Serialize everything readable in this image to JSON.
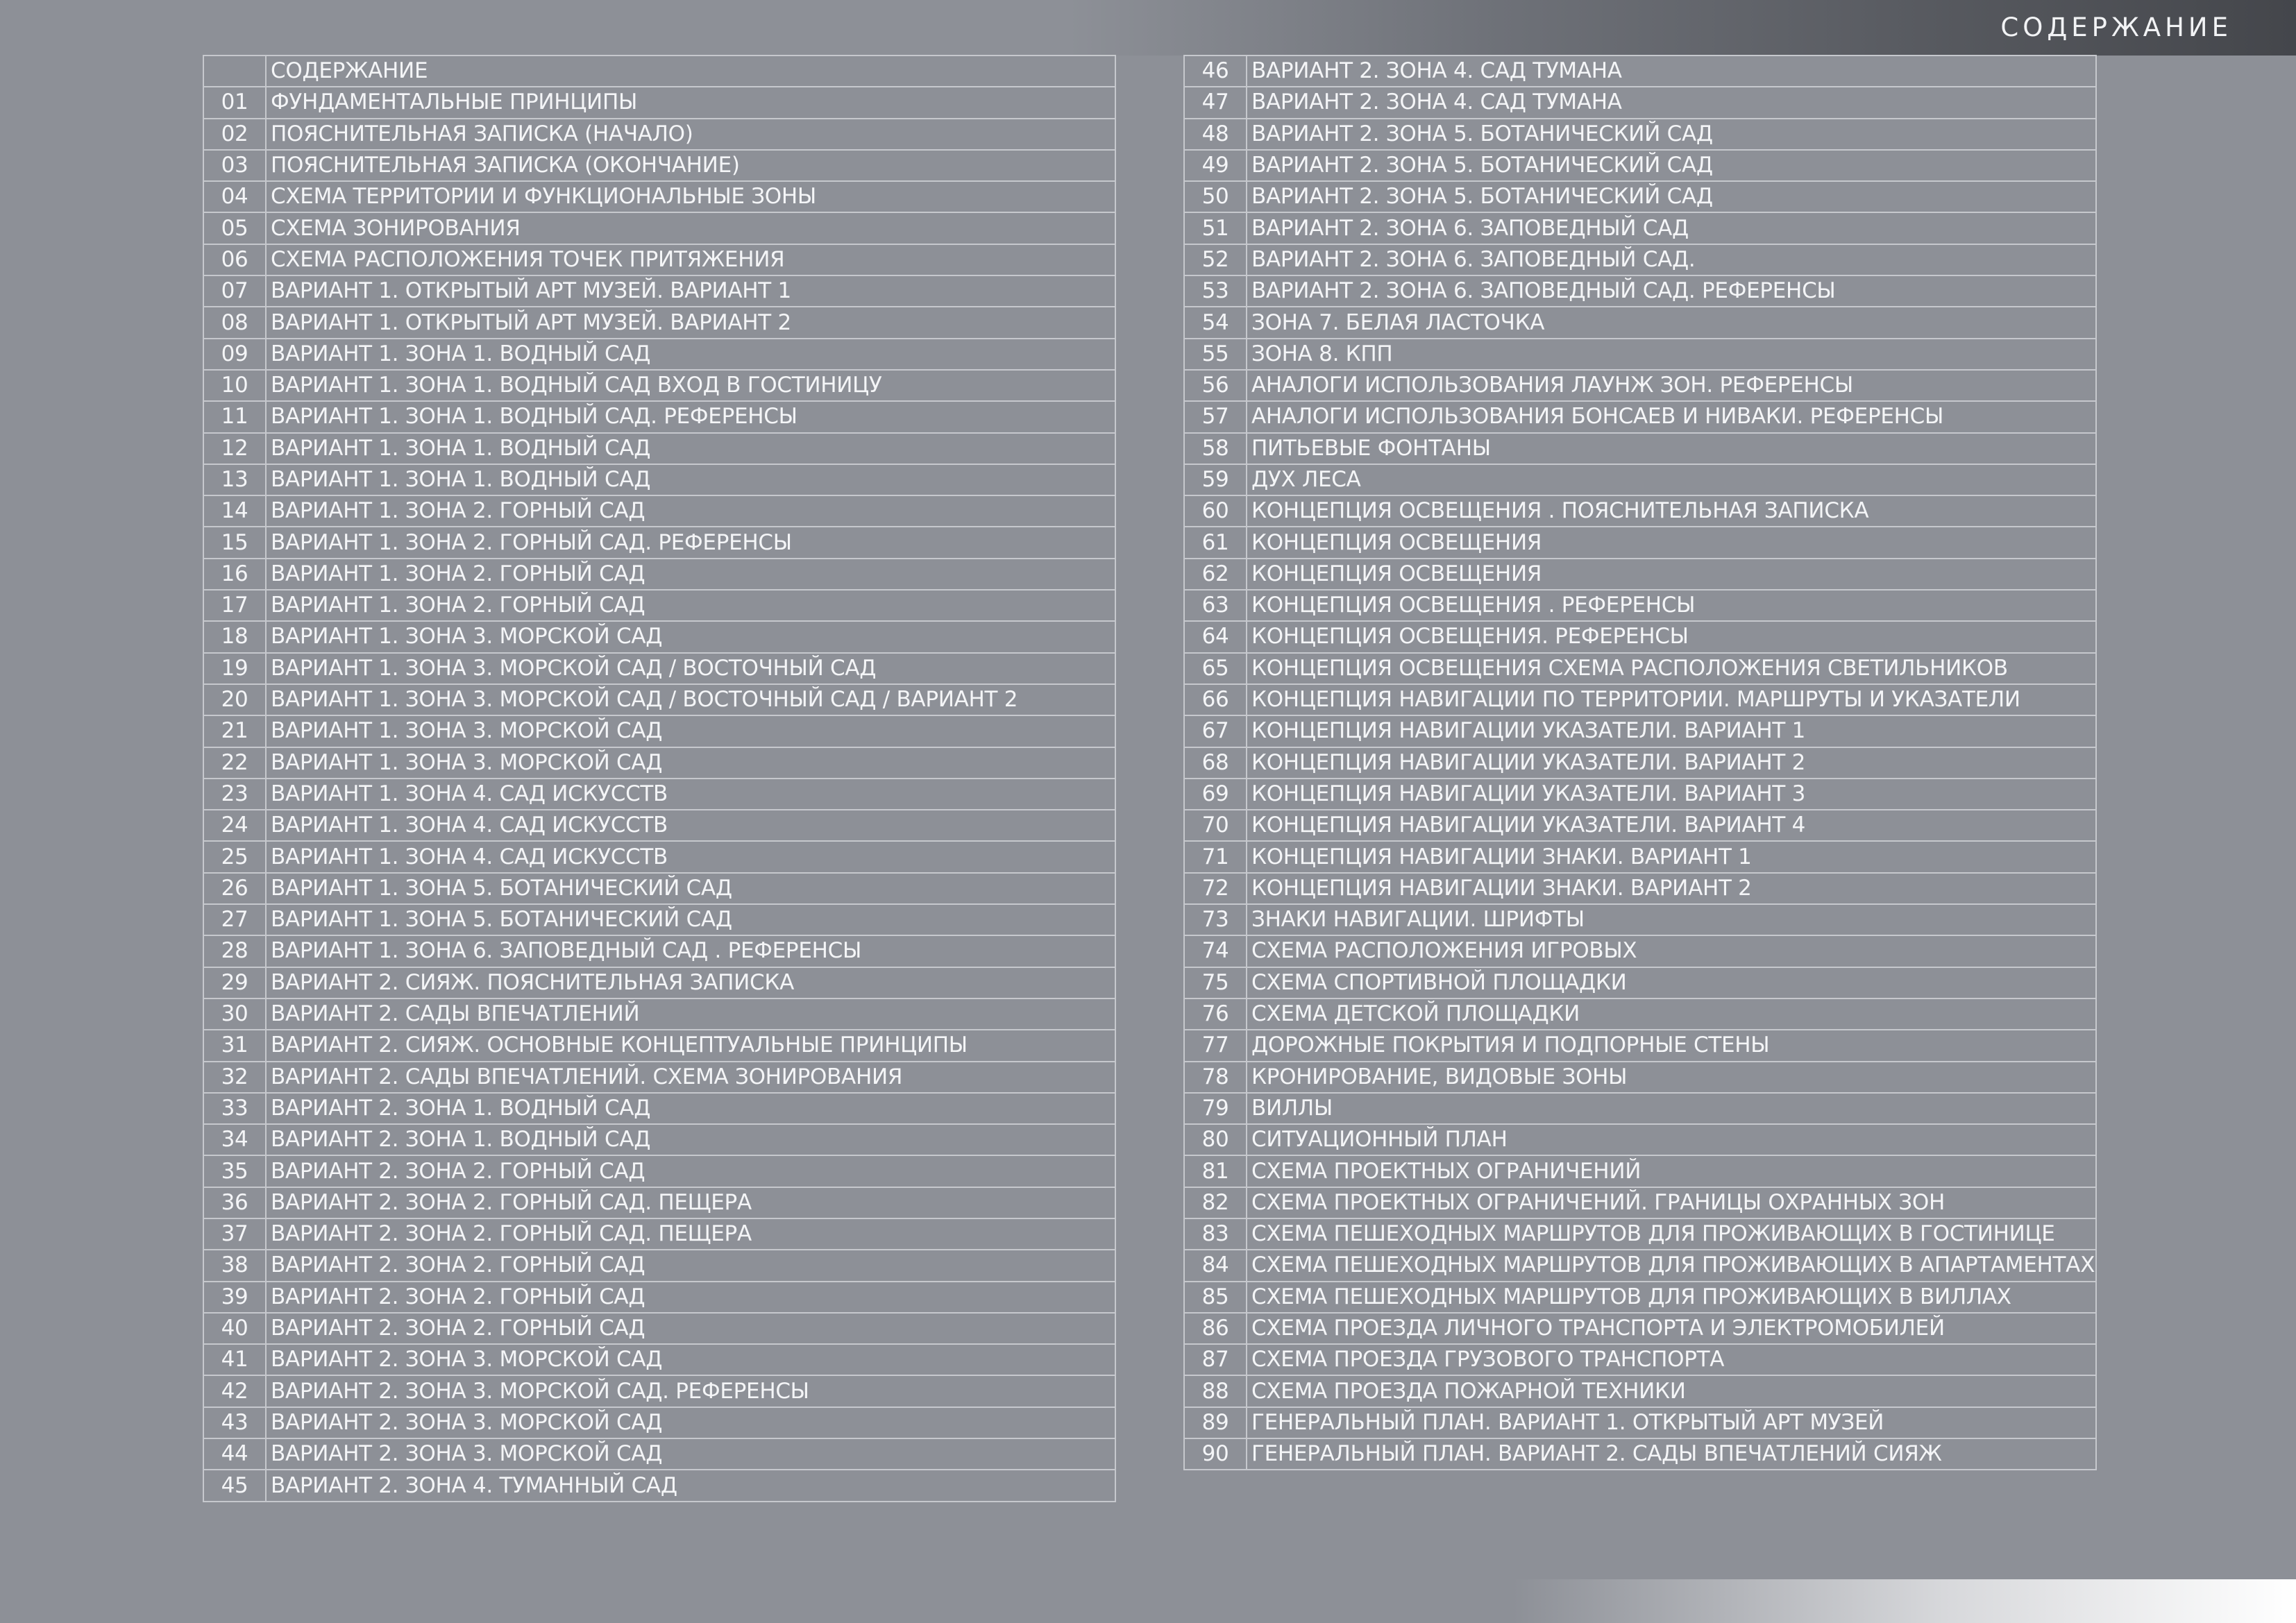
{
  "page": {
    "heading": "СОДЕРЖАНИЕ"
  },
  "toc": {
    "left": [
      {
        "num": "",
        "title": "СОДЕРЖАНИЕ"
      },
      {
        "num": "01",
        "title": "ФУНДАМЕНТАЛЬНЫЕ ПРИНЦИПЫ"
      },
      {
        "num": "02",
        "title": "ПОЯСНИТЕЛЬНАЯ ЗАПИСКА (НАЧАЛО)"
      },
      {
        "num": "03",
        "title": "ПОЯСНИТЕЛЬНАЯ ЗАПИСКА (ОКОНЧАНИЕ)"
      },
      {
        "num": "04",
        "title": "СХЕМА ТЕРРИТОРИИ И ФУНКЦИОНАЛЬНЫЕ ЗОНЫ"
      },
      {
        "num": "05",
        "title": "СХЕМА ЗОНИРОВАНИЯ"
      },
      {
        "num": "06",
        "title": "СХЕМА  РАСПОЛОЖЕНИЯ ТОЧЕК ПРИТЯЖЕНИЯ"
      },
      {
        "num": "07",
        "title": "ВАРИАНТ 1. ОТКРЫТЫЙ АРТ МУЗЕЙ. ВАРИАНТ 1"
      },
      {
        "num": "08",
        "title": "ВАРИАНТ 1. ОТКРЫТЫЙ АРТ МУЗЕЙ. ВАРИАНТ 2"
      },
      {
        "num": "09",
        "title": "ВАРИАНТ 1. ЗОНА 1. ВОДНЫЙ САД"
      },
      {
        "num": "10",
        "title": "ВАРИАНТ 1. ЗОНА 1. ВОДНЫЙ САД ВХОД В ГОСТИНИЦУ"
      },
      {
        "num": "11",
        "title": "ВАРИАНТ 1. ЗОНА 1. ВОДНЫЙ САД. РЕФЕРЕНСЫ"
      },
      {
        "num": "12",
        "title": "ВАРИАНТ 1. ЗОНА 1. ВОДНЫЙ САД"
      },
      {
        "num": "13",
        "title": "ВАРИАНТ 1. ЗОНА 1. ВОДНЫЙ САД"
      },
      {
        "num": "14",
        "title": "ВАРИАНТ 1. ЗОНА 2. ГОРНЫЙ САД"
      },
      {
        "num": "15",
        "title": "ВАРИАНТ 1. ЗОНА 2. ГОРНЫЙ САД. РЕФЕРЕНСЫ"
      },
      {
        "num": "16",
        "title": "ВАРИАНТ 1. ЗОНА 2. ГОРНЫЙ САД"
      },
      {
        "num": "17",
        "title": "ВАРИАНТ 1. ЗОНА 2. ГОРНЫЙ САД"
      },
      {
        "num": "18",
        "title": "ВАРИАНТ 1. ЗОНА 3. МОРСКОЙ САД"
      },
      {
        "num": "19",
        "title": "ВАРИАНТ 1. ЗОНА 3. МОРСКОЙ САД / ВОСТОЧНЫЙ САД"
      },
      {
        "num": "20",
        "title": "ВАРИАНТ 1. ЗОНА 3. МОРСКОЙ САД / ВОСТОЧНЫЙ САД / ВАРИАНТ 2"
      },
      {
        "num": "21",
        "title": "ВАРИАНТ 1. ЗОНА 3. МОРСКОЙ САД"
      },
      {
        "num": "22",
        "title": "ВАРИАНТ 1. ЗОНА 3. МОРСКОЙ САД"
      },
      {
        "num": "23",
        "title": "ВАРИАНТ 1. ЗОНА 4. САД ИСКУССТВ"
      },
      {
        "num": "24",
        "title": "ВАРИАНТ 1. ЗОНА 4. САД ИСКУССТВ"
      },
      {
        "num": "25",
        "title": "ВАРИАНТ 1. ЗОНА 4. САД ИСКУССТВ"
      },
      {
        "num": "26",
        "title": "ВАРИАНТ 1. ЗОНА 5. БОТАНИЧЕСКИЙ САД"
      },
      {
        "num": "27",
        "title": "ВАРИАНТ 1. ЗОНА 5. БОТАНИЧЕСКИЙ САД"
      },
      {
        "num": "28",
        "title": "ВАРИАНТ 1. ЗОНА 6. ЗАПОВЕДНЫЙ САД . РЕФЕРЕНСЫ"
      },
      {
        "num": "29",
        "title": "ВАРИАНТ 2. СИЯЖ. ПОЯСНИТЕЛЬНАЯ ЗАПИСКА"
      },
      {
        "num": "30",
        "title": "ВАРИАНТ 2. САДЫ ВПЕЧАТЛЕНИЙ"
      },
      {
        "num": "31",
        "title": "ВАРИАНТ 2. СИЯЖ. ОСНОВНЫЕ КОНЦЕПТУАЛЬНЫЕ ПРИНЦИПЫ"
      },
      {
        "num": "32",
        "title": "ВАРИАНТ 2. САДЫ ВПЕЧАТЛЕНИЙ. СХЕМА ЗОНИРОВАНИЯ"
      },
      {
        "num": "33",
        "title": "ВАРИАНТ 2. ЗОНА 1. ВОДНЫЙ САД"
      },
      {
        "num": "34",
        "title": "ВАРИАНТ 2. ЗОНА 1. ВОДНЫЙ САД"
      },
      {
        "num": "35",
        "title": "ВАРИАНТ 2. ЗОНА 2. ГОРНЫЙ САД"
      },
      {
        "num": "36",
        "title": "ВАРИАНТ 2. ЗОНА 2. ГОРНЫЙ САД. ПЕЩЕРА"
      },
      {
        "num": "37",
        "title": "ВАРИАНТ 2. ЗОНА 2. ГОРНЫЙ САД. ПЕЩЕРА"
      },
      {
        "num": "38",
        "title": "ВАРИАНТ 2. ЗОНА 2. ГОРНЫЙ САД"
      },
      {
        "num": "39",
        "title": "ВАРИАНТ 2. ЗОНА 2. ГОРНЫЙ САД"
      },
      {
        "num": "40",
        "title": "ВАРИАНТ 2. ЗОНА 2. ГОРНЫЙ САД"
      },
      {
        "num": "41",
        "title": "ВАРИАНТ 2. ЗОНА 3. МОРСКОЙ САД"
      },
      {
        "num": "42",
        "title": "ВАРИАНТ 2. ЗОНА 3. МОРСКОЙ САД. РЕФЕРЕНСЫ"
      },
      {
        "num": "43",
        "title": "ВАРИАНТ 2. ЗОНА 3. МОРСКОЙ САД"
      },
      {
        "num": "44",
        "title": "ВАРИАНТ 2. ЗОНА 3. МОРСКОЙ САД"
      },
      {
        "num": "45",
        "title": "ВАРИАНТ 2. ЗОНА 4. ТУМАННЫЙ САД"
      }
    ],
    "right": [
      {
        "num": "46",
        "title": "ВАРИАНТ 2. ЗОНА 4. САД ТУМАНА"
      },
      {
        "num": "47",
        "title": "ВАРИАНТ 2. ЗОНА 4. САД ТУМАНА"
      },
      {
        "num": "48",
        "title": "ВАРИАНТ 2. ЗОНА 5. БОТАНИЧЕСКИЙ САД"
      },
      {
        "num": "49",
        "title": "ВАРИАНТ 2. ЗОНА 5. БОТАНИЧЕСКИЙ САД"
      },
      {
        "num": "50",
        "title": "ВАРИАНТ 2. ЗОНА 5. БОТАНИЧЕСКИЙ САД"
      },
      {
        "num": "51",
        "title": "ВАРИАНТ 2. ЗОНА 6. ЗАПОВЕДНЫЙ САД"
      },
      {
        "num": "52",
        "title": "ВАРИАНТ 2. ЗОНА 6. ЗАПОВЕДНЫЙ САД."
      },
      {
        "num": "53",
        "title": "ВАРИАНТ 2. ЗОНА 6. ЗАПОВЕДНЫЙ САД. РЕФЕРЕНСЫ"
      },
      {
        "num": "54",
        "title": "ЗОНА 7. БЕЛАЯ ЛАСТОЧКА"
      },
      {
        "num": "55",
        "title": "ЗОНА 8. КПП"
      },
      {
        "num": "56",
        "title": "АНАЛОГИ  ИСПОЛЬЗОВАНИЯ ЛАУНЖ ЗОН. РЕФЕРЕНСЫ"
      },
      {
        "num": "57",
        "title": "АНАЛОГИ ИСПОЛЬЗОВАНИЯ БОНСАЕВ И НИВАКИ. РЕФЕРЕНСЫ"
      },
      {
        "num": "58",
        "title": "ПИТЬЕВЫЕ ФОНТАНЫ"
      },
      {
        "num": "59",
        "title": "ДУХ ЛЕСА"
      },
      {
        "num": "60",
        "title": "КОНЦЕПЦИЯ ОСВЕЩЕНИЯ . ПОЯСНИТЕЛЬНАЯ ЗАПИСКА"
      },
      {
        "num": "61",
        "title": "КОНЦЕПЦИЯ ОСВЕЩЕНИЯ"
      },
      {
        "num": "62",
        "title": "КОНЦЕПЦИЯ ОСВЕЩЕНИЯ"
      },
      {
        "num": "63",
        "title": "КОНЦЕПЦИЯ ОСВЕЩЕНИЯ . РЕФЕРЕНСЫ"
      },
      {
        "num": "64",
        "title": "КОНЦЕПЦИЯ ОСВЕЩЕНИЯ. РЕФЕРЕНСЫ"
      },
      {
        "num": "65",
        "title": "КОНЦЕПЦИЯ ОСВЕЩЕНИЯ СХЕМА РАСПОЛОЖЕНИЯ СВЕТИЛЬНИКОВ"
      },
      {
        "num": "66",
        "title": "КОНЦЕПЦИЯ НАВИГАЦИИ ПО ТЕРРИТОРИИ. МАРШРУТЫ И УКАЗАТЕЛИ"
      },
      {
        "num": "67",
        "title": "КОНЦЕПЦИЯ НАВИГАЦИИ УКАЗАТЕЛИ. ВАРИАНТ 1"
      },
      {
        "num": "68",
        "title": "КОНЦЕПЦИЯ НАВИГАЦИИ УКАЗАТЕЛИ. ВАРИАНТ 2"
      },
      {
        "num": "69",
        "title": "КОНЦЕПЦИЯ НАВИГАЦИИ УКАЗАТЕЛИ. ВАРИАНТ 3"
      },
      {
        "num": "70",
        "title": "КОНЦЕПЦИЯ НАВИГАЦИИ УКАЗАТЕЛИ. ВАРИАНТ 4"
      },
      {
        "num": "71",
        "title": "КОНЦЕПЦИЯ НАВИГАЦИИ ЗНАКИ. ВАРИАНТ 1"
      },
      {
        "num": "72",
        "title": "КОНЦЕПЦИЯ НАВИГАЦИИ ЗНАКИ. ВАРИАНТ 2"
      },
      {
        "num": "73",
        "title": "ЗНАКИ НАВИГАЦИИ. ШРИФТЫ"
      },
      {
        "num": "74",
        "title": "СХЕМА РАСПОЛОЖЕНИЯ ИГРОВЫХ"
      },
      {
        "num": "75",
        "title": "СХЕМА СПОРТИВНОЙ ПЛОЩАДКИ"
      },
      {
        "num": "76",
        "title": "СХЕМА ДЕТСКОЙ ПЛОЩАДКИ"
      },
      {
        "num": "77",
        "title": "ДОРОЖНЫЕ ПОКРЫТИЯ И ПОДПОРНЫЕ СТЕНЫ"
      },
      {
        "num": "78",
        "title": "КРОНИРОВАНИЕ, ВИДОВЫЕ ЗОНЫ"
      },
      {
        "num": "79",
        "title": "ВИЛЛЫ"
      },
      {
        "num": "80",
        "title": "СИТУАЦИОННЫЙ ПЛАН"
      },
      {
        "num": "81",
        "title": "СХЕМА ПРОЕКТНЫХ ОГРАНИЧЕНИЙ"
      },
      {
        "num": "82",
        "title": "СХЕМА ПРОЕКТНЫХ ОГРАНИЧЕНИЙ. ГРАНИЦЫ ОХРАННЫХ ЗОН"
      },
      {
        "num": "83",
        "title": "СХЕМА ПЕШЕХОДНЫХ МАРШРУТОВ ДЛЯ ПРОЖИВАЮЩИХ В ГОСТИНИЦЕ"
      },
      {
        "num": "84",
        "title": "СХЕМА  ПЕШЕХОДНЫХ МАРШРУТОВ ДЛЯ ПРОЖИВАЮЩИХ В АПАРТАМЕНТАХ"
      },
      {
        "num": "85",
        "title": "СХЕМА ПЕШЕХОДНЫХ МАРШРУТОВ ДЛЯ ПРОЖИВАЮЩИХ В ВИЛЛАХ"
      },
      {
        "num": "86",
        "title": " СХЕМА ПРОЕЗДА ЛИЧНОГО ТРАНСПОРТА И ЭЛЕКТРОМОБИЛЕЙ"
      },
      {
        "num": "87",
        "title": "СХЕМА ПРОЕЗДА ГРУЗОВОГО ТРАНСПОРТА"
      },
      {
        "num": "88",
        "title": "СХЕМА ПРОЕЗДА ПОЖАРНОЙ ТЕХНИКИ"
      },
      {
        "num": "89",
        "title": "ГЕНЕРАЛЬНЫЙ ПЛАН. ВАРИАНТ 1. ОТКРЫТЫЙ АРТ МУЗЕЙ"
      },
      {
        "num": "90",
        "title": "ГЕНЕРАЛЬНЫЙ ПЛАН. ВАРИАНТ 2. САДЫ ВПЕЧАТЛЕНИЙ СИЯЖ"
      }
    ]
  }
}
